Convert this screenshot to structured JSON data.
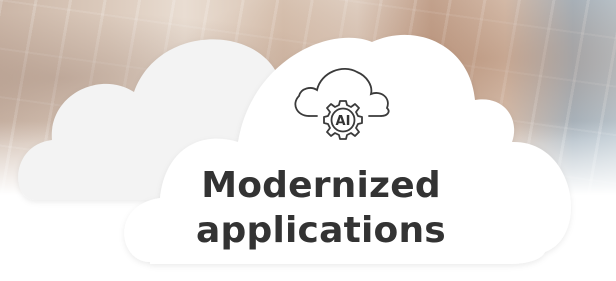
{
  "card": {
    "title_line_1": "Modernized",
    "title_line_2": "applications"
  },
  "icon": {
    "name": "cloud-ai-gear-icon",
    "badge_text": "AI"
  },
  "colors": {
    "text": "#333333",
    "cloud_fill": "#ffffff",
    "icon_stroke": "#3a3a3a"
  }
}
